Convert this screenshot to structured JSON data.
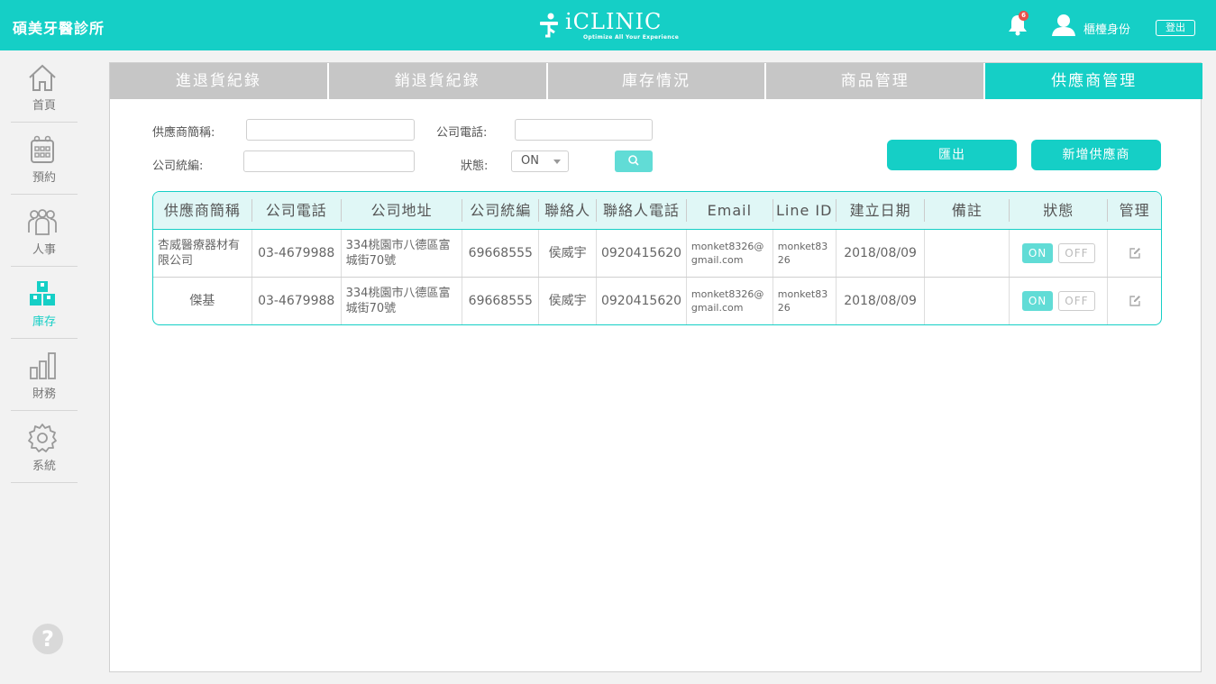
{
  "header": {
    "clinic_name": "碩美牙醫診所",
    "logo_title": "iCLINIC",
    "logo_subtitle": "Optimize All Your Experience",
    "notification_count": "6",
    "user_label": "櫃檯身份",
    "logout_label": "登出"
  },
  "sidebar": {
    "items": [
      {
        "label": "首頁",
        "icon": "home-icon"
      },
      {
        "label": "預約",
        "icon": "calendar-icon"
      },
      {
        "label": "人事",
        "icon": "people-icon"
      },
      {
        "label": "庫存",
        "icon": "inventory-icon"
      },
      {
        "label": "財務",
        "icon": "bar-chart-icon"
      },
      {
        "label": "系統",
        "icon": "gear-icon"
      }
    ],
    "active": "庫存",
    "help_label": "?"
  },
  "tabs": [
    {
      "label": "進退貨紀錄"
    },
    {
      "label": "銷退貨紀錄"
    },
    {
      "label": "庫存情況"
    },
    {
      "label": "商品管理"
    },
    {
      "label": "供應商管理",
      "active": true
    }
  ],
  "filters": {
    "supplier_abbr_label": "供應商簡稱:",
    "company_phone_label": "公司電話:",
    "company_tax_label": "公司統編:",
    "status_label": "狀態:",
    "status_value": "ON",
    "supplier_abbr_value": "",
    "company_phone_value": "",
    "company_tax_value": ""
  },
  "actions": {
    "export_label": "匯出",
    "add_supplier_label": "新增供應商"
  },
  "table": {
    "headers": [
      "供應商簡稱",
      "公司電話",
      "公司地址",
      "公司統編",
      "聯絡人",
      "聯絡人電話",
      "Email",
      "Line ID",
      "建立日期",
      "備註",
      "狀態",
      "管理"
    ],
    "rows": [
      {
        "name": "杏威醫療器材有限公司",
        "phone": "03-4679988",
        "address": "334桃園市八德區富城街70號",
        "tax_id": "69668555",
        "contact": "侯威宇",
        "contact_phone": "0920415620",
        "email": "monket8326@gmail.com",
        "line_id": "monket8326",
        "created": "2018/08/09",
        "note": "",
        "status_on": "ON",
        "status_off": "OFF"
      },
      {
        "name": "傑基",
        "phone": "03-4679988",
        "address": "334桃園市八德區富城街70號",
        "tax_id": "69668555",
        "contact": "侯威宇",
        "contact_phone": "0920415620",
        "email": "monket8326@gmail.com",
        "line_id": "monket8326",
        "created": "2018/08/09",
        "note": "",
        "status_on": "ON",
        "status_off": "OFF"
      }
    ]
  },
  "colors": {
    "accent": "#15cfc6",
    "tab_inactive": "#c6c6c6",
    "badge": "#e8504b"
  }
}
